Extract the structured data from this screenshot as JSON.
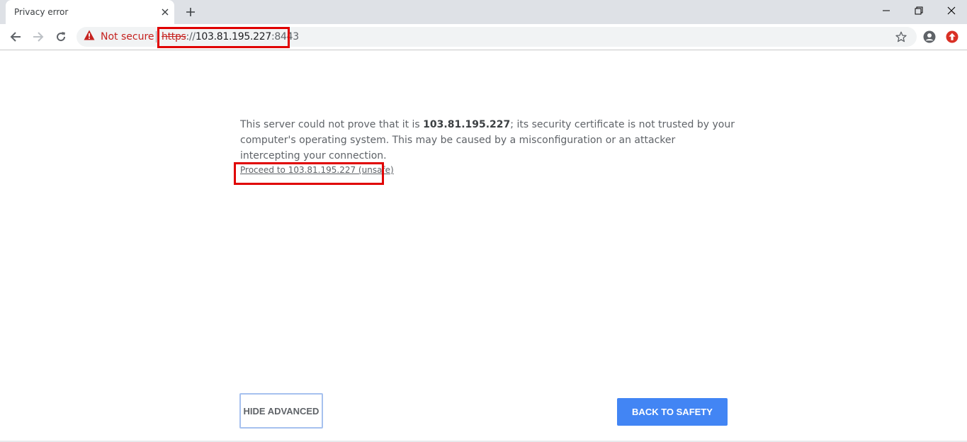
{
  "browser": {
    "tab": {
      "title": "Privacy error"
    },
    "address": {
      "security_label": "Not secure",
      "url_scheme": "https",
      "url_separator": "://",
      "url_host": "103.81.195.227",
      "url_port": ":8443"
    }
  },
  "interstitial": {
    "details_prefix": "This server could not prove that it is ",
    "details_host": "103.81.195.227",
    "details_suffix": "; its security certificate is not trusted by your computer's operating system. This may be caused by a misconfiguration or an attacker intercepting your connection.",
    "proceed_link": "Proceed to 103.81.195.227 (unsafe)",
    "hide_advanced_button": "HIDE ADVANCED",
    "back_to_safety_button": "BACK TO SAFETY"
  },
  "colors": {
    "warning_red": "#c5221f",
    "annotation_red": "#e00000",
    "primary_blue": "#4285f4",
    "text_gray": "#5f6368"
  },
  "icons": [
    "close-icon",
    "plus-icon",
    "minimize-icon",
    "restore-icon",
    "window-close-icon",
    "back-arrow-icon",
    "forward-arrow-icon",
    "reload-icon",
    "warning-triangle-icon",
    "star-icon",
    "profile-icon",
    "extension-icon"
  ]
}
